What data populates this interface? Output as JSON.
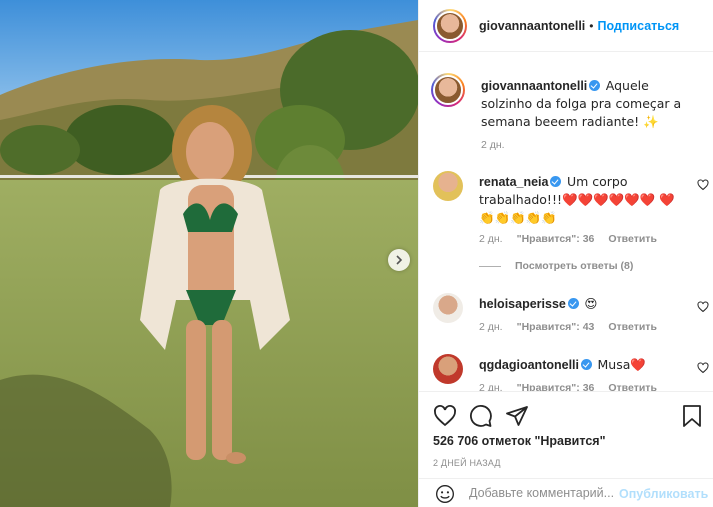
{
  "header": {
    "username": "giovannaantonelli",
    "separator": "•",
    "follow_label": "Подписаться"
  },
  "caption": {
    "username": "giovannaantonelli",
    "text": "Aquele solzinho da folga pra começar a semana beeem radiante! ✨",
    "time": "2 дн."
  },
  "comments": [
    {
      "username": "renata_neia",
      "verified": true,
      "text": "Um corpo trabalhado!!!❤️❤️❤️❤️❤️❤️ ❤️👏👏👏👏👏",
      "time": "2 дн.",
      "likes": "\"Нравится\": 36",
      "reply": "Ответить"
    },
    {
      "username": "heloisaperisse",
      "verified": true,
      "text": "😍",
      "time": "2 дн.",
      "likes": "\"Нравится\": 43",
      "reply": "Ответить"
    },
    {
      "username": "qgdagioantonelli",
      "verified": true,
      "text": "Musa❤️",
      "time": "2 дн.",
      "likes": "\"Нравится\": 36",
      "reply": "Ответить"
    }
  ],
  "view_replies": "Посмотреть ответы (8)",
  "likes_text": "526 706 отметок \"Нравится\"",
  "timestamp": "2 ДНЕЙ НАЗАД",
  "comment_box": {
    "placeholder": "Добавьте комментарий...",
    "publish_label": "Опубликовать"
  },
  "colors": {
    "accent": "#0095f6",
    "publish_disabled": "#b2dffc",
    "verified": "#3897f0",
    "text_secondary": "#8e8e8e"
  }
}
